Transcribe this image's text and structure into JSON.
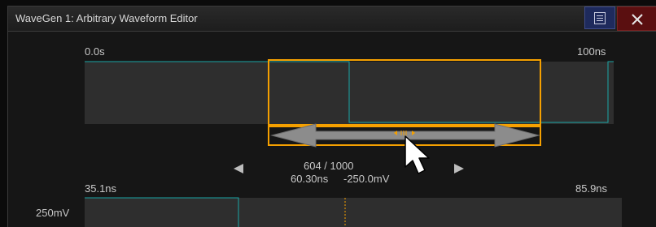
{
  "window": {
    "title": "WaveGen 1: Arbitrary Waveform Editor"
  },
  "icons": {
    "menu": "menu-icon",
    "close": "close-icon",
    "left_arrow": "triangle-left-icon",
    "right_arrow": "triangle-right-icon",
    "cursor": "mouse-pointer-icon",
    "grip": "drag-grip-icon"
  },
  "colors": {
    "accent": "#f5a000",
    "waveform": "#1aa6a6",
    "menu_button": "#1e2a5c",
    "close_button": "#5a0f10",
    "plot_background": "#2e2e2e"
  },
  "overview": {
    "start_time": "0.0s",
    "end_time": "100ns"
  },
  "navigator": {
    "point_index": "604 / 1000",
    "point_time": "60.30ns",
    "point_voltage": "-250.0mV"
  },
  "zoom_view": {
    "start_time": "35.1ns",
    "end_time": "85.9ns",
    "voltage_label": "250mV"
  }
}
